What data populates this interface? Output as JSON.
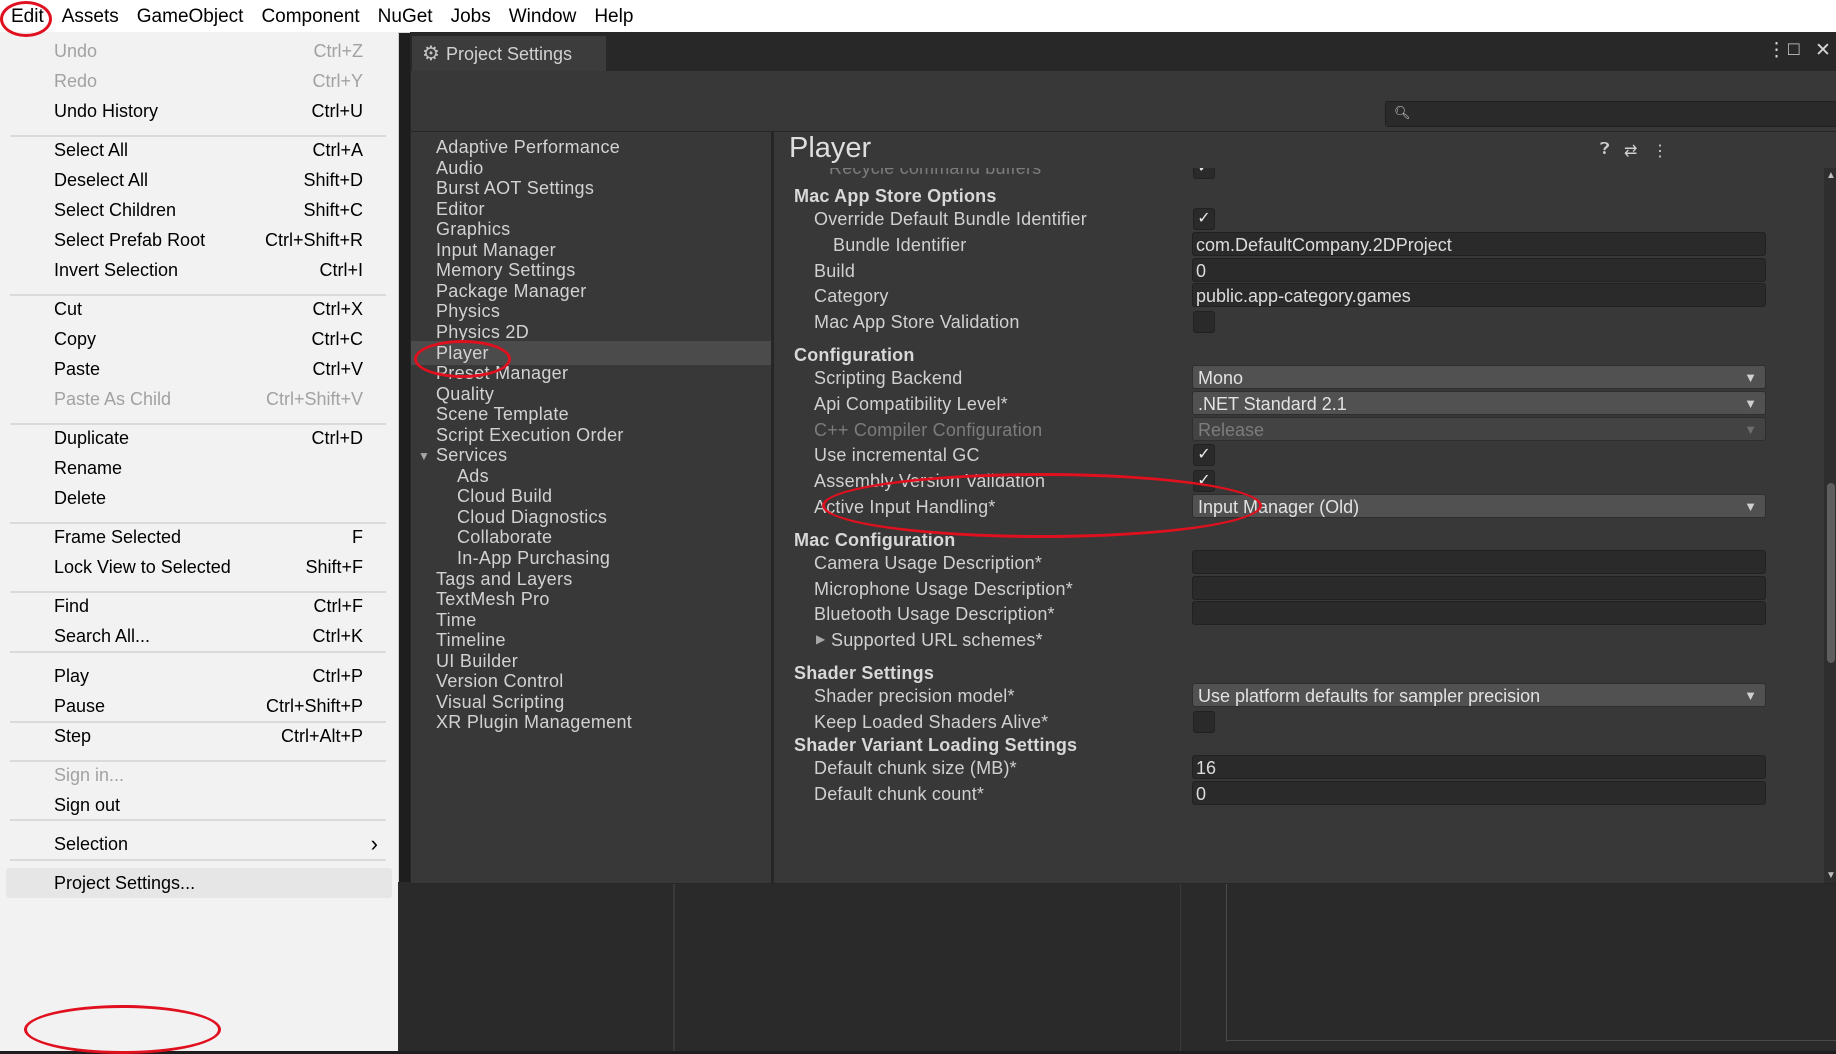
{
  "menubar": [
    "Edit",
    "Assets",
    "GameObject",
    "Component",
    "NuGet",
    "Jobs",
    "Window",
    "Help"
  ],
  "edit_menu": [
    {
      "label": "Undo",
      "shortcut": "Ctrl+Z",
      "disabled": true
    },
    {
      "label": "Redo",
      "shortcut": "Ctrl+Y",
      "disabled": true
    },
    {
      "label": "Undo History",
      "shortcut": "Ctrl+U"
    },
    {
      "label": "Select All",
      "shortcut": "Ctrl+A"
    },
    {
      "label": "Deselect All",
      "shortcut": "Shift+D"
    },
    {
      "label": "Select Children",
      "shortcut": "Shift+C"
    },
    {
      "label": "Select Prefab Root",
      "shortcut": "Ctrl+Shift+R"
    },
    {
      "label": "Invert Selection",
      "shortcut": "Ctrl+I"
    },
    {
      "label": "Cut",
      "shortcut": "Ctrl+X"
    },
    {
      "label": "Copy",
      "shortcut": "Ctrl+C"
    },
    {
      "label": "Paste",
      "shortcut": "Ctrl+V"
    },
    {
      "label": "Paste As Child",
      "shortcut": "Ctrl+Shift+V",
      "disabled": true
    },
    {
      "label": "Duplicate",
      "shortcut": "Ctrl+D"
    },
    {
      "label": "Rename",
      "shortcut": ""
    },
    {
      "label": "Delete",
      "shortcut": ""
    },
    {
      "label": "Frame Selected",
      "shortcut": "F"
    },
    {
      "label": "Lock View to Selected",
      "shortcut": "Shift+F"
    },
    {
      "label": "Find",
      "shortcut": "Ctrl+F"
    },
    {
      "label": "Search All...",
      "shortcut": "Ctrl+K"
    },
    {
      "label": "Play",
      "shortcut": "Ctrl+P"
    },
    {
      "label": "Pause",
      "shortcut": "Ctrl+Shift+P"
    },
    {
      "label": "Step",
      "shortcut": "Ctrl+Alt+P"
    },
    {
      "label": "Sign in...",
      "shortcut": "",
      "disabled": true
    },
    {
      "label": "Sign out",
      "shortcut": ""
    },
    {
      "label": "Selection",
      "shortcut": "",
      "submenu": true
    },
    {
      "label": "Project Settings...",
      "shortcut": "",
      "highlighted": true
    }
  ],
  "window": {
    "tab_title": "Project Settings",
    "search_placeholder": ""
  },
  "settings_nav": [
    {
      "label": "Adaptive Performance"
    },
    {
      "label": "Audio"
    },
    {
      "label": "Burst AOT Settings"
    },
    {
      "label": "Editor"
    },
    {
      "label": "Graphics"
    },
    {
      "label": "Input Manager"
    },
    {
      "label": "Memory Settings"
    },
    {
      "label": "Package Manager"
    },
    {
      "label": "Physics"
    },
    {
      "label": "Physics 2D"
    },
    {
      "label": "Player",
      "selected": true
    },
    {
      "label": "Preset Manager"
    },
    {
      "label": "Quality"
    },
    {
      "label": "Scene Template"
    },
    {
      "label": "Script Execution Order"
    },
    {
      "label": "Services",
      "expanded": true
    },
    {
      "label": "Ads",
      "child": true
    },
    {
      "label": "Cloud Build",
      "child": true
    },
    {
      "label": "Cloud Diagnostics",
      "child": true
    },
    {
      "label": "Collaborate",
      "child": true
    },
    {
      "label": "In-App Purchasing",
      "child": true
    },
    {
      "label": "Tags and Layers"
    },
    {
      "label": "TextMesh Pro"
    },
    {
      "label": "Time"
    },
    {
      "label": "Timeline"
    },
    {
      "label": "UI Builder"
    },
    {
      "label": "Version Control"
    },
    {
      "label": "Visual Scripting"
    },
    {
      "label": "XR Plugin Management"
    }
  ],
  "player": {
    "title": "Player",
    "cut_off_label": "Recycle command buffers",
    "rows": [
      {
        "type": "header",
        "label": "Mac App Store Options"
      },
      {
        "type": "checkbox",
        "label": "Override Default Bundle Identifier",
        "checked": true,
        "indent": 1
      },
      {
        "type": "text",
        "label": "Bundle Identifier",
        "value": "com.DefaultCompany.2DProject",
        "indent": 2
      },
      {
        "type": "text",
        "label": "Build",
        "value": "0",
        "indent": 1
      },
      {
        "type": "text",
        "label": "Category",
        "value": "public.app-category.games",
        "indent": 1
      },
      {
        "type": "checkbox",
        "label": "Mac App Store Validation",
        "checked": false,
        "indent": 1
      },
      {
        "type": "header",
        "label": "Configuration"
      },
      {
        "type": "dropdown",
        "label": "Scripting Backend",
        "value": "Mono",
        "indent": 1
      },
      {
        "type": "dropdown",
        "label": "Api Compatibility Level*",
        "value": ".NET Standard 2.1",
        "indent": 1
      },
      {
        "type": "dropdown",
        "label": "C++ Compiler Configuration",
        "value": "Release",
        "indent": 1,
        "disabled": true
      },
      {
        "type": "checkbox",
        "label": "Use incremental GC",
        "checked": true,
        "indent": 1
      },
      {
        "type": "checkbox",
        "label": "Assembly Version Validation",
        "checked": true,
        "indent": 1
      },
      {
        "type": "dropdown",
        "label": "Active Input Handling*",
        "value": "Input Manager (Old)",
        "indent": 1
      },
      {
        "type": "header",
        "label": "Mac Configuration"
      },
      {
        "type": "text",
        "label": "Camera Usage Description*",
        "value": "",
        "indent": 1
      },
      {
        "type": "text",
        "label": "Microphone Usage Description*",
        "value": "",
        "indent": 1
      },
      {
        "type": "text",
        "label": "Bluetooth Usage Description*",
        "value": "",
        "indent": 1
      },
      {
        "type": "foldout",
        "label": "Supported URL schemes*",
        "indent": 1
      },
      {
        "type": "header",
        "label": "Shader Settings"
      },
      {
        "type": "dropdown",
        "label": "Shader precision model*",
        "value": "Use platform defaults for sampler precision",
        "indent": 1
      },
      {
        "type": "checkbox",
        "label": "Keep Loaded Shaders Alive*",
        "checked": false,
        "indent": 1
      },
      {
        "type": "header",
        "label": "Shader Variant Loading Settings"
      },
      {
        "type": "text",
        "label": "Default chunk size (MB)*",
        "value": "16",
        "indent": 1
      },
      {
        "type": "text",
        "label": "Default chunk count*",
        "value": "0",
        "indent": 1
      }
    ]
  },
  "colors": {
    "annotation": "#e0101f",
    "window_bg": "#383838",
    "menu_bg": "#f2f2f2"
  }
}
